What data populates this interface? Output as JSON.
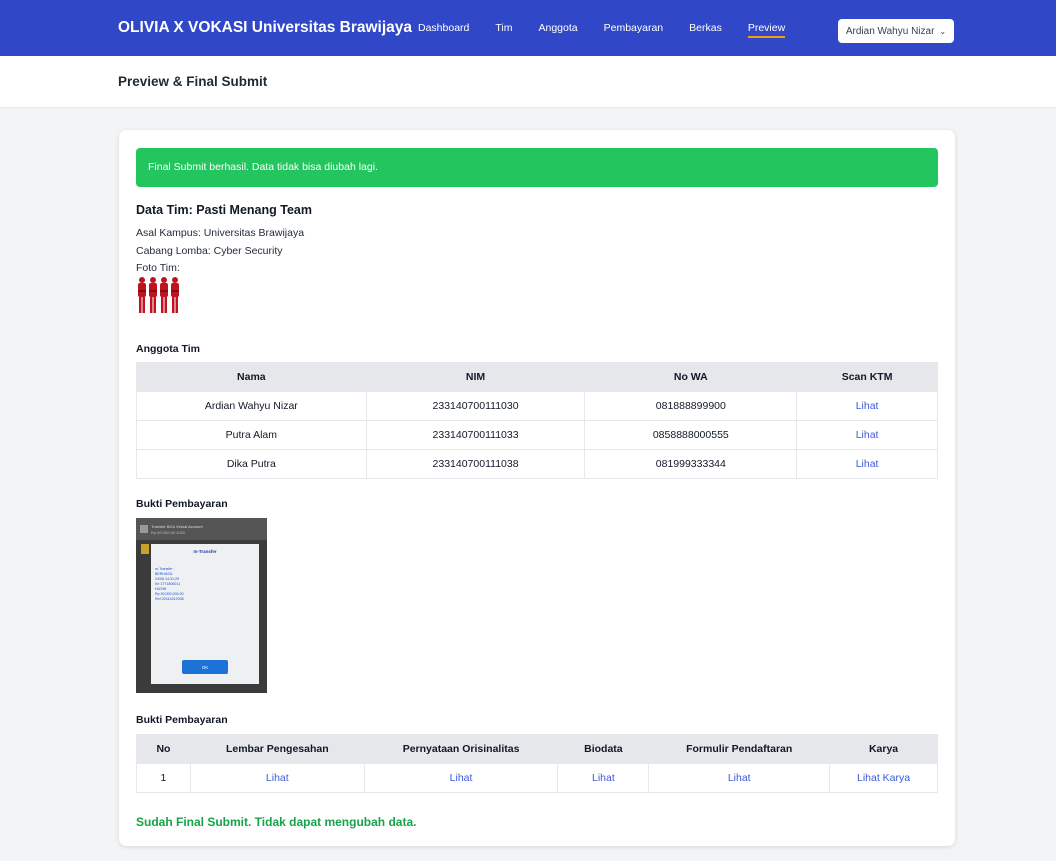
{
  "nav": {
    "brand": "OLIVIA X VOKASI Universitas Brawijaya",
    "links": [
      "Dashboard",
      "Tim",
      "Anggota",
      "Pembayaran",
      "Berkas",
      "Preview"
    ],
    "active": "Preview",
    "user": "Ardian Wahyu Nizar"
  },
  "page": {
    "title": "Preview & Final Submit"
  },
  "alert": {
    "text": "Final Submit berhasil. Data tidak bisa diubah lagi."
  },
  "team": {
    "title": "Data Tim: Pasti Menang Team",
    "campus": "Asal Kampus: Universitas Brawijaya",
    "branch": "Cabang Lomba: Cyber Security",
    "photo_label": "Foto Tim:"
  },
  "members": {
    "title": "Anggota Tim",
    "headers": [
      "Nama",
      "NIM",
      "No WA",
      "Scan KTM"
    ],
    "rows": [
      [
        "Ardian Wahyu Nizar",
        "233140700111030",
        "081888899900",
        "Lihat"
      ],
      [
        "Putra Alam",
        "233140700111033",
        "0858888000555",
        "Lihat"
      ],
      [
        "Dika Putra",
        "233140700111038",
        "081999333344",
        "Lihat"
      ]
    ]
  },
  "payment": {
    "title": "Bukti Pembayaran",
    "image_texts": {
      "header1": "Transfer BCA Virtual Account",
      "header2": "Rp.50.000.00 1000",
      "dialog_title": "m-Transfer",
      "lines": [
        "m-Transfer :",
        "BERHASIL",
        "24/06 14:31:29",
        "Ke 1771806011",
        "HUSIN",
        "Rp 50,000,000.00",
        "Ref 02414312936"
      ],
      "ok": "OK"
    }
  },
  "files": {
    "title": "Bukti Pembayaran",
    "headers": [
      "No",
      "Lembar Pengesahan",
      "Pernyataan Orisinalitas",
      "Biodata",
      "Formulir Pendaftaran",
      "Karya"
    ],
    "rows": [
      [
        "1",
        "Lihat",
        "Lihat",
        "Lihat",
        "Lihat",
        "Lihat Karya"
      ]
    ]
  },
  "final_note": "Sudah Final Submit. Tidak dapat mengubah data.",
  "colors": {
    "nav": "#3048c8",
    "success": "#22c55e",
    "link": "#3b5bdb",
    "note": "#16a34a"
  }
}
